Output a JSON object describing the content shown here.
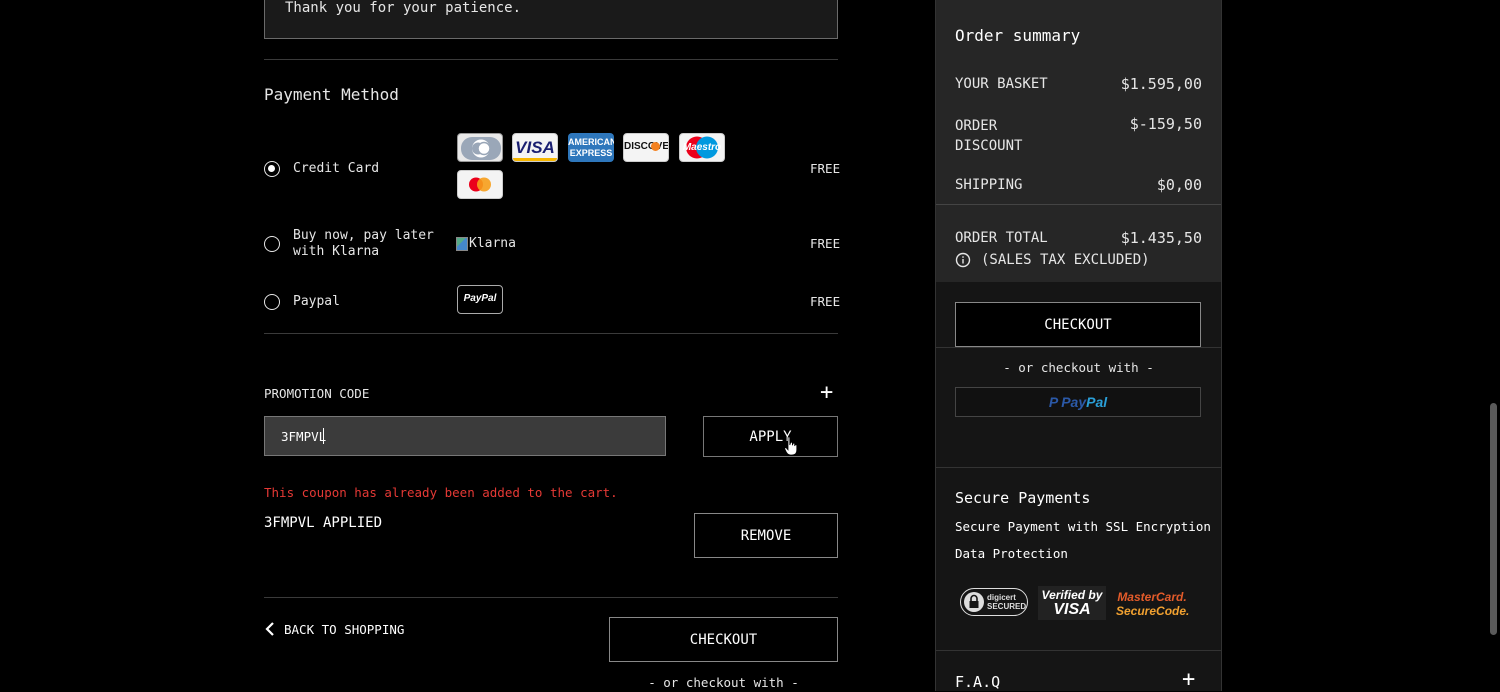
{
  "notice": {
    "text": "Thank you for your patience."
  },
  "payment": {
    "title": "Payment Method",
    "options": [
      {
        "label": "Credit Card",
        "price": "FREE",
        "selected": true
      },
      {
        "label": "Buy now, pay later with Klarna",
        "label_line1": "Buy now, pay later",
        "label_line2": "with Klarna",
        "price": "FREE",
        "selected": false,
        "logo_alt": "Klarna"
      },
      {
        "label": "Paypal",
        "price": "FREE",
        "selected": false
      }
    ],
    "cards": [
      {
        "name": "diners-club-icon",
        "text": ""
      },
      {
        "name": "visa-icon",
        "text": "VISA"
      },
      {
        "name": "amex-icon",
        "text1": "AMERICAN",
        "text2": "EXPRESS"
      },
      {
        "name": "discover-icon",
        "text": "DISCOVER"
      },
      {
        "name": "maestro-icon",
        "text": "Maestro"
      },
      {
        "name": "mastercard-icon",
        "text": ""
      }
    ],
    "paypal_logo": "PayPal"
  },
  "promo": {
    "label": "PROMOTION CODE",
    "toggle": "+",
    "input_value": "3FMPVL",
    "apply_label": "APPLY",
    "error": "This coupon has already been added to the cart.",
    "applied_text": "3FMPVL APPLIED",
    "remove_label": "REMOVE"
  },
  "footer": {
    "back_label": "BACK TO SHOPPING",
    "checkout_label": "CHECKOUT",
    "or_checkout": "- or checkout with -"
  },
  "summary": {
    "title": "Order summary",
    "basket_label": "YOUR BASKET",
    "basket_value": "$1.595,00",
    "discount_label_1": "ORDER",
    "discount_label_2": "DISCOUNT",
    "discount_value": "$-159,50",
    "shipping_label": "SHIPPING",
    "shipping_value": "$0,00",
    "total_label": "ORDER TOTAL",
    "total_value": "$1.435,50",
    "tax_note": "(SALES TAX EXCLUDED)",
    "checkout_label": "CHECKOUT",
    "or_checkout": "- or checkout with -",
    "paypal_p": "Pay",
    "paypal_pal": "Pal"
  },
  "secure": {
    "title": "Secure Payments",
    "line1": "Secure Payment with SSL Encryption",
    "line2": "Data Protection",
    "badges": {
      "digicert_1": "digicert",
      "digicert_2": "SECURED",
      "verified_1": "Verified by",
      "verified_2": "VISA",
      "mc_1": "MasterCard.",
      "mc_2": "SecureCode."
    }
  },
  "faq": {
    "title": "F.A.Q",
    "toggle": "+"
  },
  "colors": {
    "error": "#e53935",
    "paypal_dark": "#253b80",
    "paypal_light": "#179bd7"
  }
}
